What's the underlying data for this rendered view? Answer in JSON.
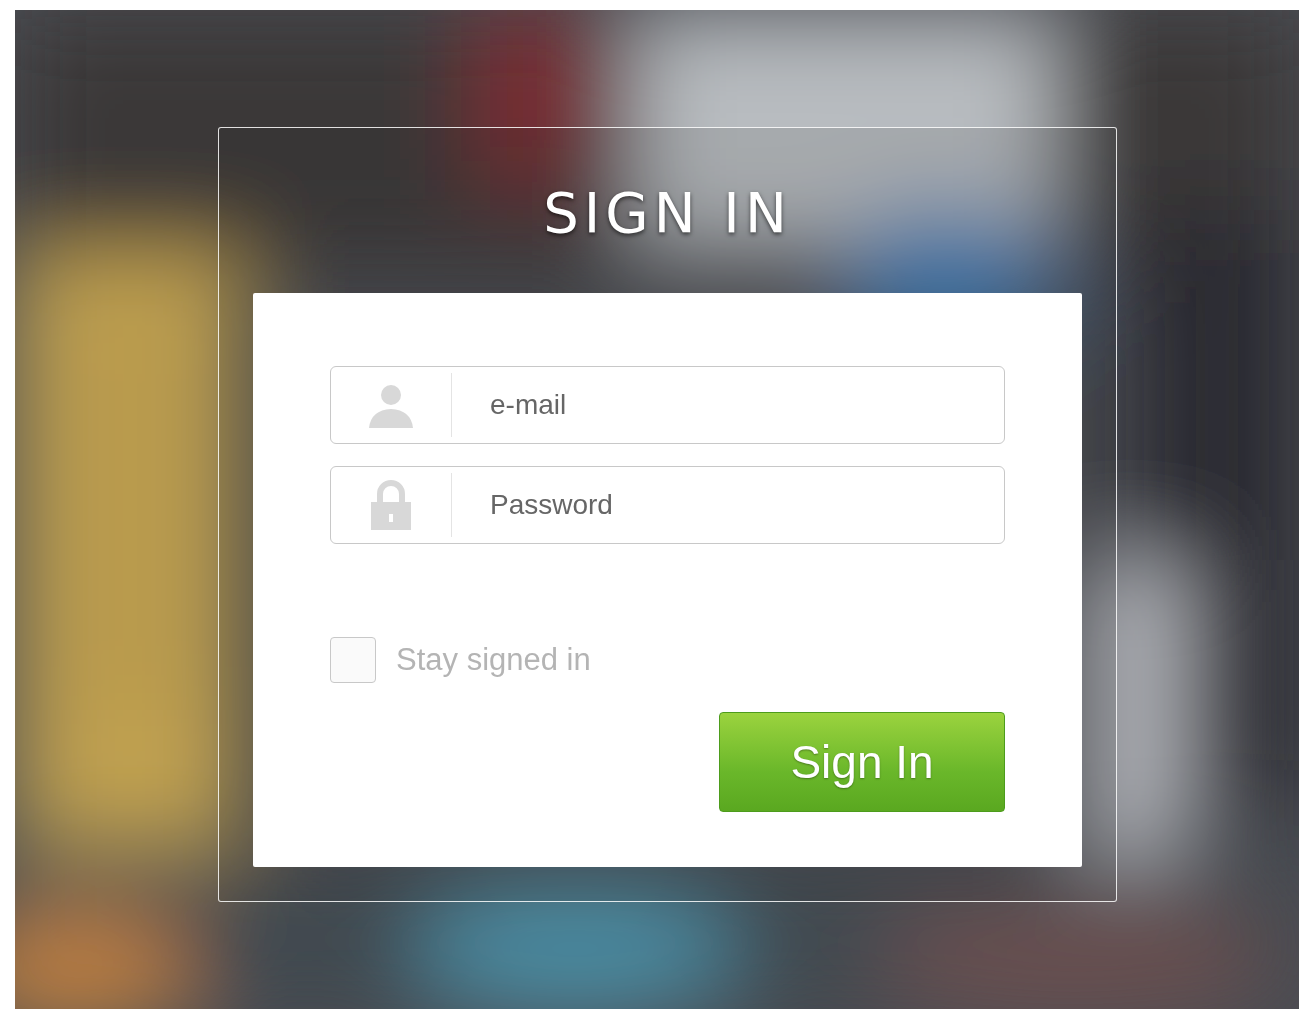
{
  "title": "SIGN IN",
  "fields": [
    {
      "kind": "email",
      "placeholder": "e-mail"
    },
    {
      "kind": "password",
      "placeholder": "Password"
    }
  ],
  "stay_signed_in": {
    "label": "Stay signed in",
    "checked": false
  },
  "submit_button": "Sign In"
}
